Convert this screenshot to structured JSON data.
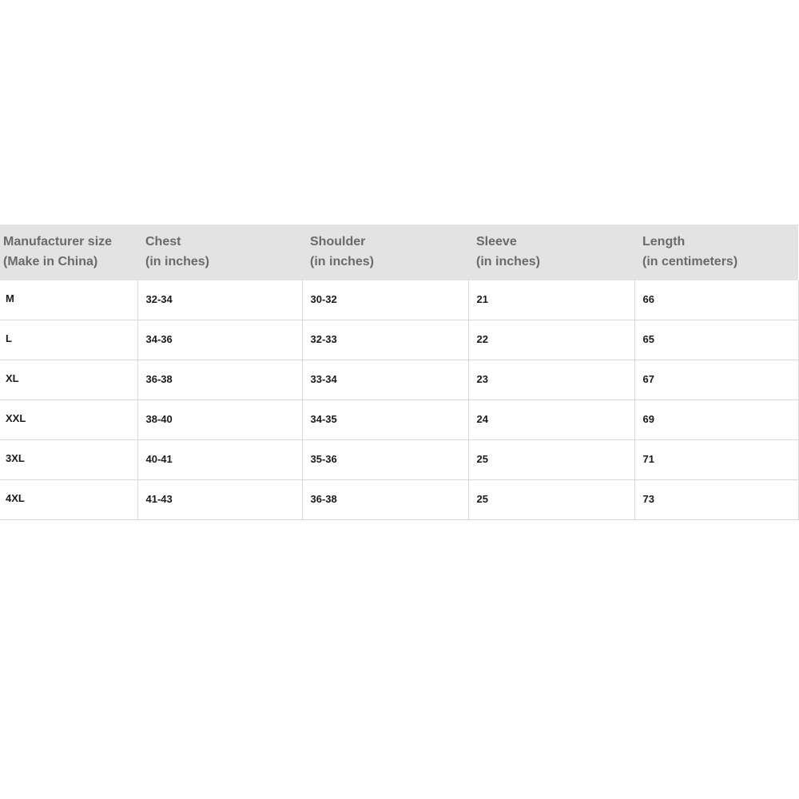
{
  "table": {
    "headers": [
      {
        "line1": "Manufacturer size",
        "line2": "(Make in China)"
      },
      {
        "line1": "Chest",
        "line2": "(in inches)"
      },
      {
        "line1": "Shoulder",
        "line2": "(in inches)"
      },
      {
        "line1": "Sleeve",
        "line2": "(in inches)"
      },
      {
        "line1": "Length",
        "line2": "(in centimeters)"
      }
    ],
    "rows": [
      [
        "M",
        "32-34",
        "30-32",
        "21",
        "66"
      ],
      [
        "L",
        "34-36",
        "32-33",
        "22",
        "65"
      ],
      [
        "XL",
        "36-38",
        "33-34",
        "23",
        "67"
      ],
      [
        "XXL",
        "38-40",
        "34-35",
        "24",
        "69"
      ],
      [
        "3XL",
        "40-41",
        "35-36",
        "25",
        "71"
      ],
      [
        "4XL",
        "41-43",
        "36-38",
        "25",
        "73"
      ]
    ]
  },
  "colors": {
    "header_background": "#e3e3e3",
    "header_text": "#6a6a6a",
    "cell_text": "#1a1a1a",
    "grid_line": "#d9d9d9"
  }
}
